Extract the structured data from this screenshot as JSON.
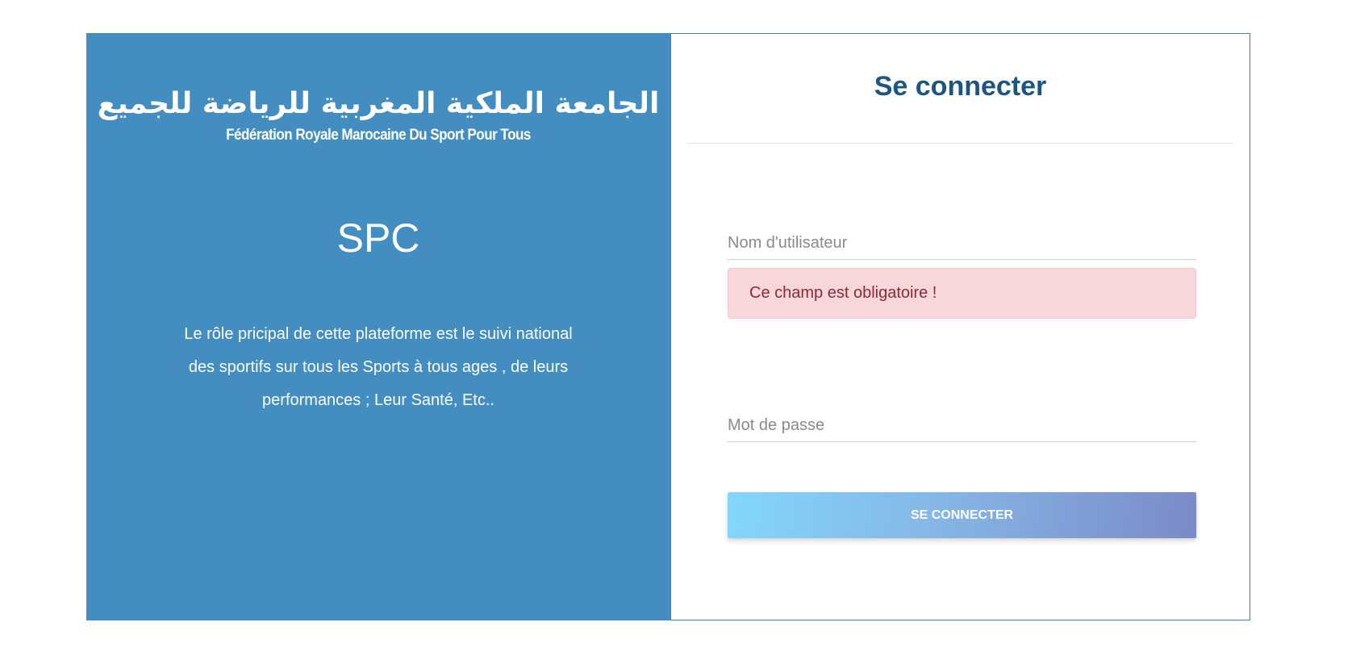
{
  "brand": {
    "logo_arabic": "الجامعة الملكية المغربية للرياضة للجميع",
    "logo_latin": "Fédération Royale Marocaine Du Sport Pour Tous",
    "app_name": "SPC",
    "description": "Le rôle pricipal de cette plateforme est le suivi national des sportifs sur tous les Sports à tous ages , de leurs performances ; Leur Santé, Etc..",
    "panel_color": "#438dc0"
  },
  "login_form": {
    "title": "Se connecter",
    "username": {
      "placeholder": "Nom d'utilisateur",
      "value": ""
    },
    "username_error": "Ce champ est obligatoire !",
    "password": {
      "placeholder": "Mot de passe",
      "value": ""
    },
    "submit_label": "SE CONNECTER",
    "title_color": "#1b5582",
    "error_background": "#f8d7da"
  }
}
